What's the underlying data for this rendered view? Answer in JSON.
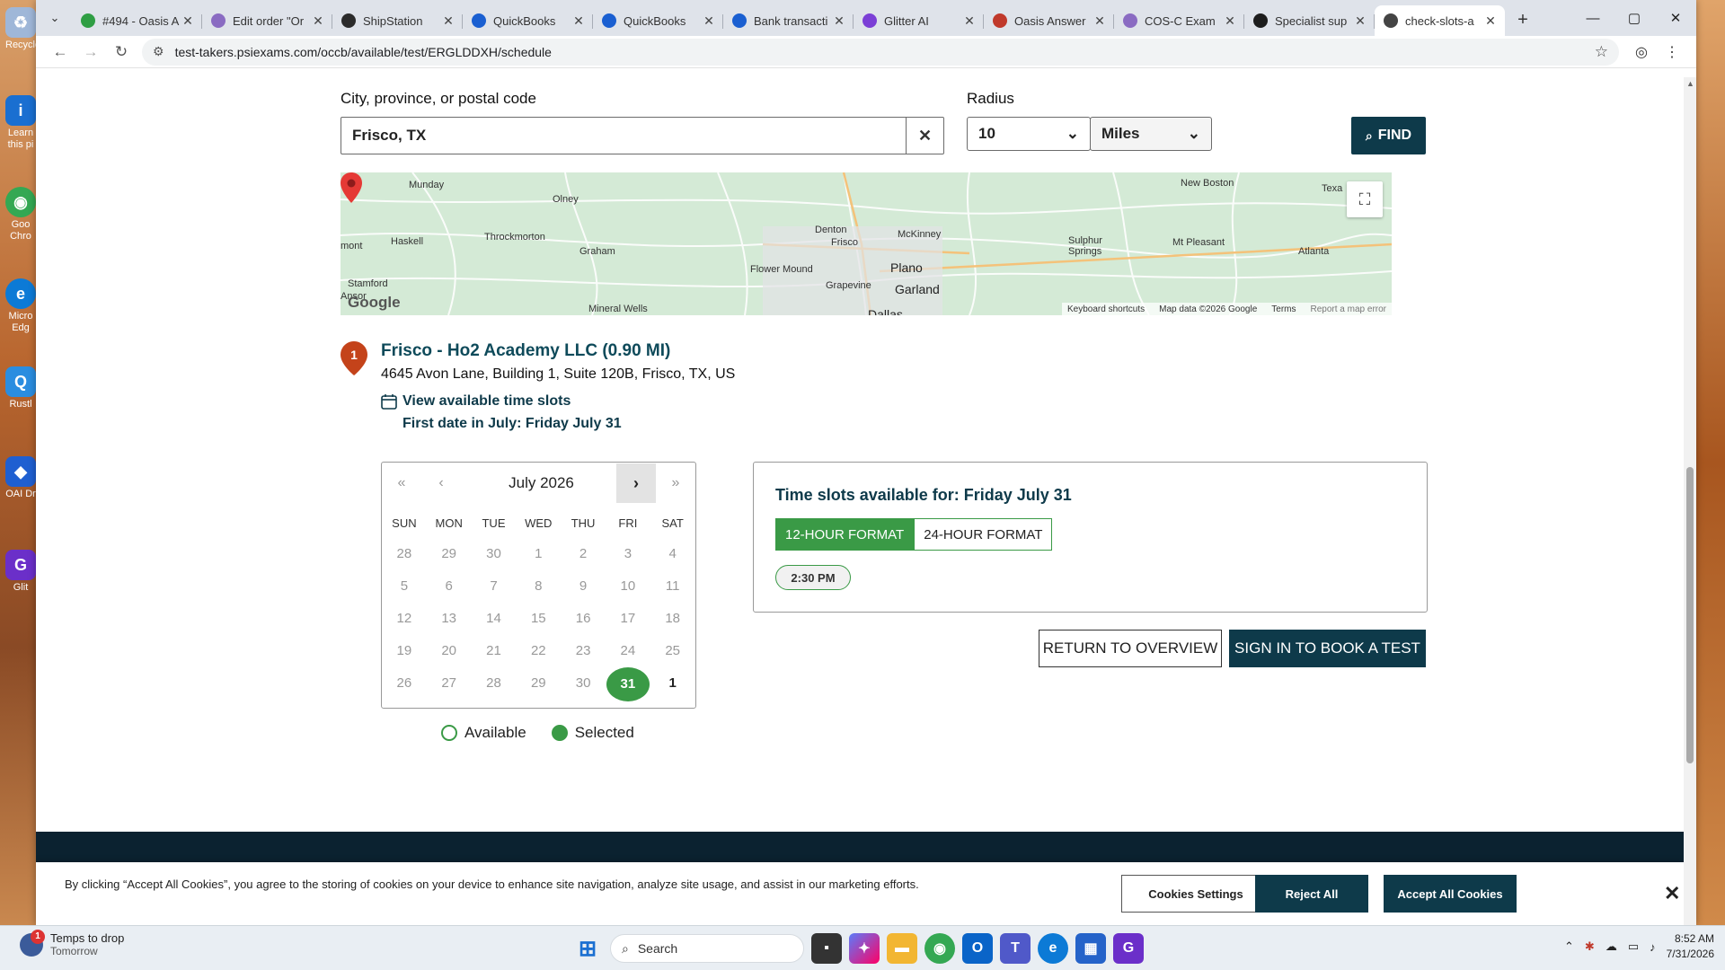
{
  "browser": {
    "tabs": [
      {
        "title": "#494 - Oasis A",
        "fav_color": "#2f9e44",
        "icon": "leaf-icon"
      },
      {
        "title": "Edit order \"Or",
        "fav_color": "#8a6bc2",
        "icon": "edit-icon"
      },
      {
        "title": "ShipStation",
        "fav_color": "#2b2b2b",
        "icon": "gear-icon"
      },
      {
        "title": "QuickBooks",
        "fav_color": "#1a5fd1",
        "icon": "info-icon"
      },
      {
        "title": "QuickBooks",
        "fav_color": "#1a5fd1",
        "icon": "info-icon"
      },
      {
        "title": "Bank transacti",
        "fav_color": "#1a5fd1",
        "icon": "info-icon"
      },
      {
        "title": "Glitter AI",
        "fav_color": "#7b3fd6",
        "icon": "glitter-icon"
      },
      {
        "title": "Oasis Answer",
        "fav_color": "#c0392b",
        "icon": "shield-icon"
      },
      {
        "title": "COS-C Exam",
        "fav_color": "#8a6bc2",
        "icon": "edit-icon"
      },
      {
        "title": "Specialist sup",
        "fav_color": "#1d1d1d",
        "icon": "asterisk-icon"
      },
      {
        "title": "check-slots-a",
        "fav_color": "#444",
        "icon": "psi-icon",
        "active": true
      }
    ],
    "url": "test-takers.psiexams.com/occb/available/test/ERGLDDXH/schedule"
  },
  "search": {
    "city_label": "City, province, or postal code",
    "city_value": "Frisco, TX",
    "radius_label": "Radius",
    "radius_value": "10",
    "units_value": "Miles",
    "find_label": "FIND"
  },
  "map": {
    "labels": [
      "Munday",
      "Olney",
      "Haskell",
      "Throckmorton",
      "Graham",
      "Stamford",
      "Mineral Wells",
      "Denton",
      "Frisco",
      "McKinney",
      "Flower Mound",
      "Plano",
      "Grapevine",
      "Garland",
      "Dallas",
      "New Boston",
      "Sulphur Springs",
      "Mt Pleasant",
      "Atlanta",
      "Texa",
      "mont",
      "Ansor"
    ],
    "google": "Google",
    "footer": [
      "Keyboard shortcuts",
      "Map data ©2026 Google",
      "Terms",
      "Report a map error"
    ]
  },
  "location": {
    "number": "1",
    "title": "Frisco - Ho2 Academy LLC (0.90 MI)",
    "address": "4645 Avon Lane, Building 1, Suite 120B, Frisco, TX, US",
    "view_slots": "View available time slots",
    "first_date": "First date in July: Friday July 31"
  },
  "calendar": {
    "month": "July 2026",
    "nav": {
      "first": "«",
      "prev": "‹",
      "next": "›",
      "last": "»"
    },
    "dow": [
      "SUN",
      "MON",
      "TUE",
      "WED",
      "THU",
      "FRI",
      "SAT"
    ],
    "weeks": [
      [
        "28",
        "29",
        "30",
        "1",
        "2",
        "3",
        "4"
      ],
      [
        "5",
        "6",
        "7",
        "8",
        "9",
        "10",
        "11"
      ],
      [
        "12",
        "13",
        "14",
        "15",
        "16",
        "17",
        "18"
      ],
      [
        "19",
        "20",
        "21",
        "22",
        "23",
        "24",
        "25"
      ],
      [
        "26",
        "27",
        "28",
        "29",
        "30",
        "31",
        "1"
      ]
    ],
    "selected": "31"
  },
  "legend": {
    "available": "Available",
    "selected": "Selected"
  },
  "slots": {
    "title": "Time slots available for: Friday July 31",
    "format_12": "12-HOUR FORMAT",
    "format_24": "24-HOUR FORMAT",
    "times": [
      "2:30 PM"
    ]
  },
  "actions": {
    "return": "RETURN TO OVERVIEW",
    "signin": "SIGN IN TO BOOK A TEST"
  },
  "cookies": {
    "text": "By clicking “Accept All Cookies”, you agree to the storing of cookies on your device to enhance site navigation, analyze site usage, and assist in our marketing efforts.",
    "settings": "Cookies Settings",
    "reject": "Reject All",
    "accept": "Accept All Cookies"
  },
  "desktop": {
    "icons": [
      "Recycle",
      "Learn this pi",
      "Goo Chro",
      "Micro Edg",
      "Rustl",
      "OAI Dr",
      "Glit"
    ]
  },
  "taskbar": {
    "weather_badge": "1",
    "weather_line1": "Temps to drop",
    "weather_line2": "Tomorrow",
    "search_placeholder": "Search",
    "time": "8:52 AM",
    "date": "7/31/2026"
  },
  "colors": {
    "brand_dark": "#0e3a4a",
    "accent_green": "#3a9a46"
  }
}
